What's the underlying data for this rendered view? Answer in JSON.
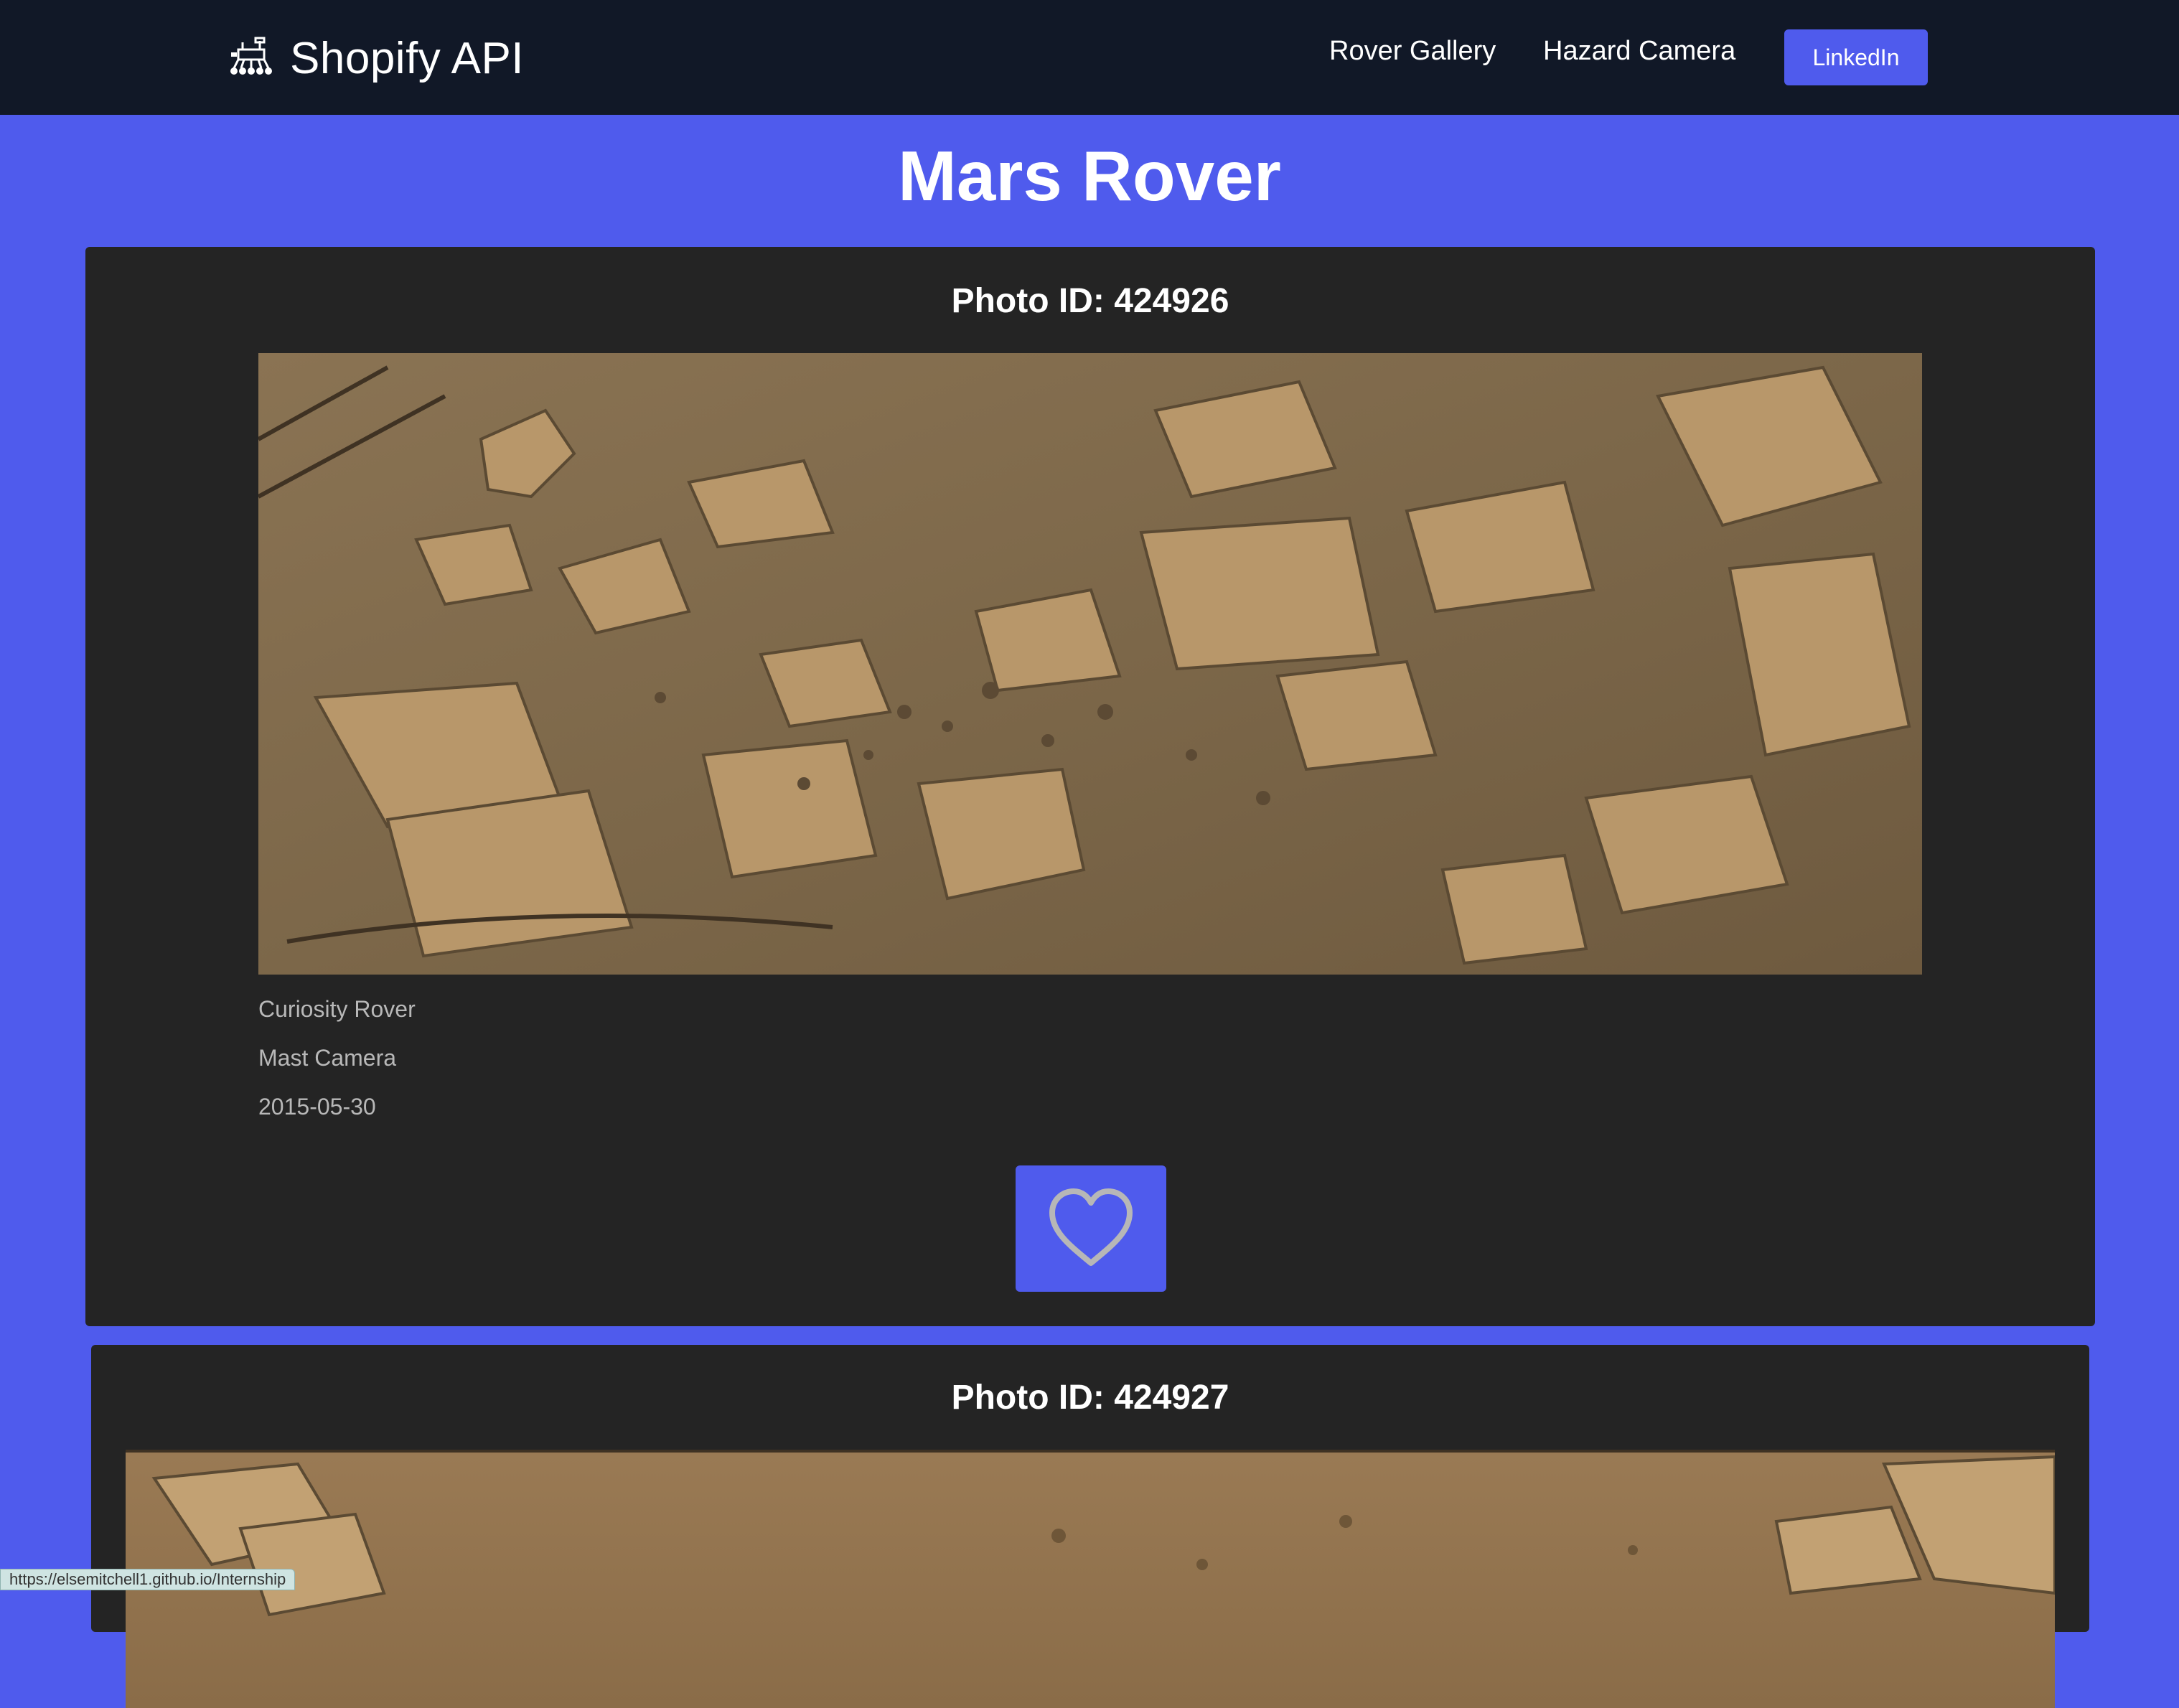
{
  "navbar": {
    "brand_icon": "rover-icon",
    "brand_text": "Shopify API",
    "links": [
      "Rover Gallery",
      "Hazard Camera"
    ],
    "linkedin_label": "LinkedIn"
  },
  "page": {
    "title": "Mars Rover"
  },
  "cards": [
    {
      "title": "Photo ID: 424926",
      "rover": "Curiosity Rover",
      "camera": "Mast Camera",
      "date": "2015-05-30",
      "like_icon": "heart-icon"
    },
    {
      "title": "Photo ID: 424927"
    }
  ],
  "status_bar": {
    "url": "https://elsemitchell1.github.io/Internship"
  },
  "colors": {
    "page_background": "#4f5bed",
    "navbar_background": "#111827",
    "card_background": "#242424",
    "accent": "#4f5bed",
    "meta_text": "#b8b8b8"
  }
}
